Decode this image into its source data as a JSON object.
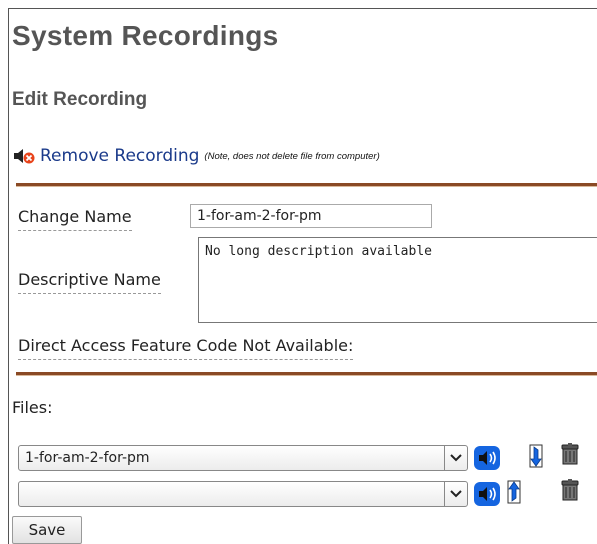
{
  "page": {
    "title": "System Recordings",
    "subtitle": "Edit Recording"
  },
  "remove": {
    "link_label": "Remove Recording",
    "note": "(Note, does not delete file from computer)"
  },
  "form": {
    "change_name_label": "Change Name",
    "change_name_value": "1-for-am-2-for-pm",
    "descriptive_name_label": "Descriptive Name",
    "descriptive_name_value": "No long description available",
    "feature_code_label": "Direct Access Feature Code Not Available:"
  },
  "files": {
    "label": "Files:",
    "rows": [
      {
        "selected": "1-for-am-2-for-pm"
      },
      {
        "selected": ""
      }
    ]
  },
  "actions": {
    "save_label": "Save"
  },
  "colors": {
    "heading": "#555555",
    "link": "#1a3a8a",
    "divider": "#8a4a25",
    "play_icon": "#1565e0"
  }
}
